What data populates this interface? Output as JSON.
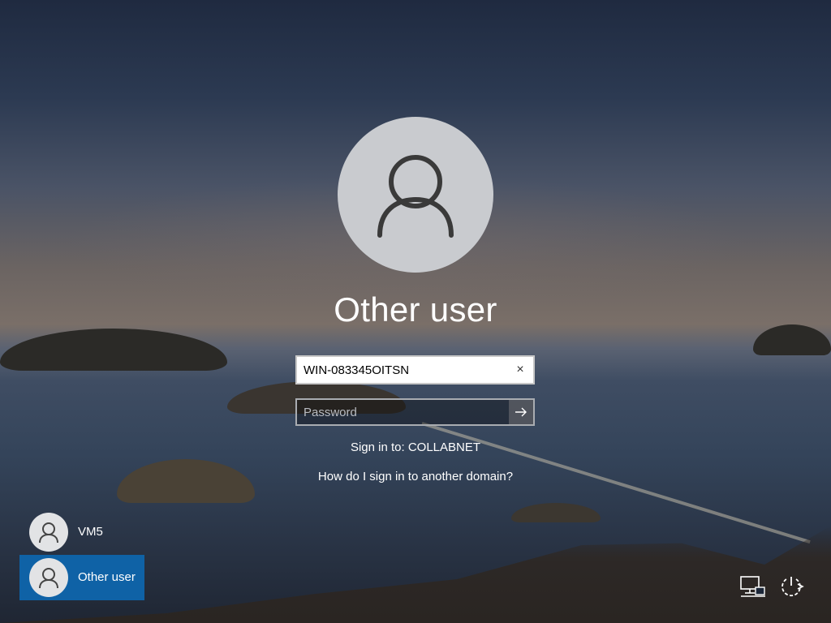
{
  "lock_screen": {
    "title": "Other user"
  },
  "login": {
    "username_value": "WIN-083345OITSN",
    "clear_glyph": "×",
    "password_placeholder": "Password",
    "sign_in_to": "Sign in to: COLLABNET",
    "other_domain_link": "How do I sign in to another domain?"
  },
  "user_list": {
    "items": [
      {
        "name": "VM5",
        "selected": false
      },
      {
        "name": "Other user",
        "selected": true
      }
    ]
  },
  "icons": {
    "avatar": "user-icon",
    "submit": "arrow-right-icon",
    "clear": "close-icon",
    "network": "network-icon",
    "power": "power-icon"
  },
  "colors": {
    "selected_user_bg": "#0f62a6",
    "avatar_bg": "#c9cbcf",
    "text": "#ffffff"
  }
}
